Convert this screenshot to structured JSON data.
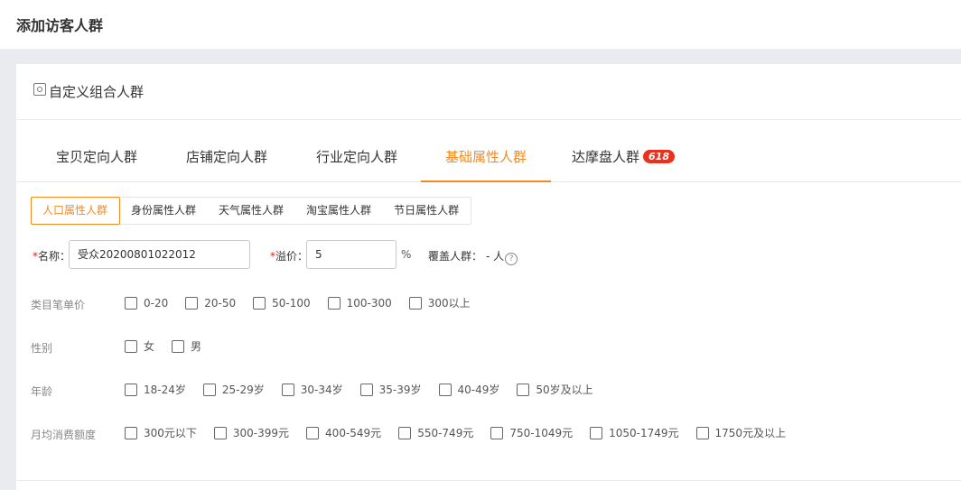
{
  "page_title": "添加访客人群",
  "card": {
    "title": "自定义组合人群",
    "icon": "portrait-icon"
  },
  "tabs": [
    {
      "label": "宝贝定向人群"
    },
    {
      "label": "店铺定向人群"
    },
    {
      "label": "行业定向人群"
    },
    {
      "label": "基础属性人群",
      "active": true
    },
    {
      "label": "达摩盘人群",
      "badge": "618"
    }
  ],
  "subtabs": [
    {
      "label": "人口属性人群",
      "active": true
    },
    {
      "label": "身份属性人群"
    },
    {
      "label": "天气属性人群"
    },
    {
      "label": "淘宝属性人群"
    },
    {
      "label": "节日属性人群"
    }
  ],
  "form": {
    "required_mark": "*",
    "name_label": "名称：",
    "name_value": "受众20200801022012",
    "premium_label": "溢价：",
    "premium_value": "5",
    "percent": "%",
    "coverage_label": "覆盖人群：",
    "coverage_value": "- 人",
    "help_icon": "question-circle-icon"
  },
  "filters": [
    {
      "label": "类目笔单价",
      "options": [
        "0-20",
        "20-50",
        "50-100",
        "100-300",
        "300以上"
      ]
    },
    {
      "label": "性别",
      "options": [
        "女",
        "男"
      ]
    },
    {
      "label": "年龄",
      "options": [
        "18-24岁",
        "25-29岁",
        "30-34岁",
        "35-39岁",
        "40-49岁",
        "50岁及以上"
      ]
    },
    {
      "label": "月均消费额度",
      "options": [
        "300元以下",
        "300-399元",
        "400-549元",
        "550-749元",
        "750-1049元",
        "1050-1749元",
        "1750元及以上"
      ]
    }
  ],
  "colors": {
    "accent": "#f5891e",
    "badge": "#e8321e",
    "page_bg": "#e9ebef"
  }
}
